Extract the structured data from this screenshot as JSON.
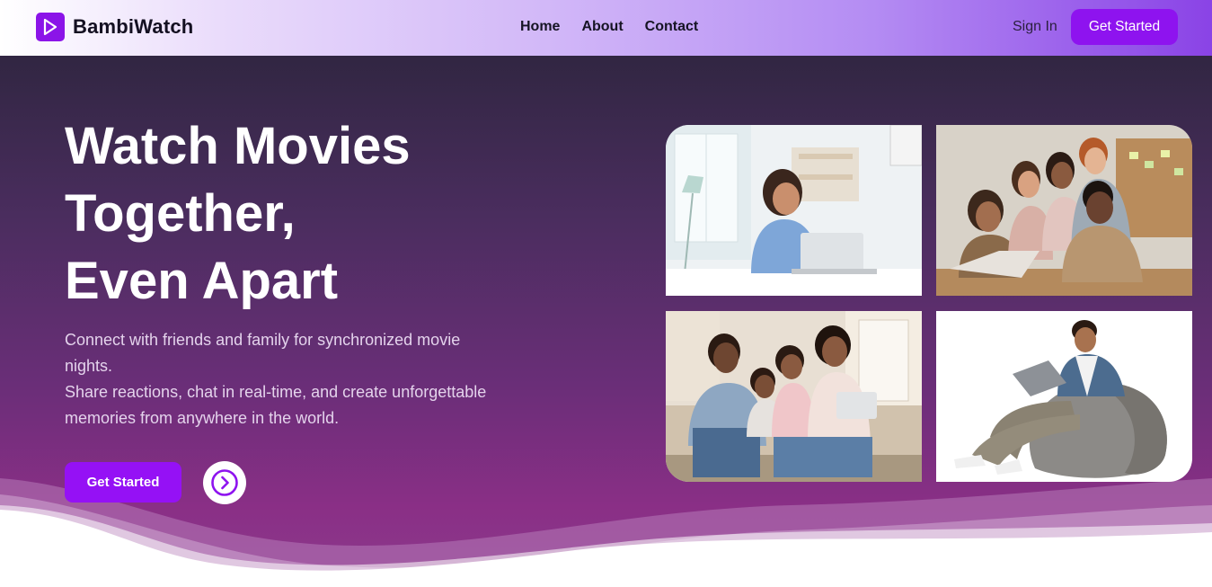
{
  "brand": {
    "name": "BambiWatch",
    "logo_icon": "play-icon",
    "accent": "#8b14e8"
  },
  "nav": {
    "links": [
      "Home",
      "About",
      "Contact"
    ],
    "sign_in": "Sign In",
    "cta": "Get Started"
  },
  "hero": {
    "title_lines": [
      "Watch Movies",
      "Together,",
      "Even Apart"
    ],
    "subtitle_lines": [
      "Connect with friends and family for synchronized movie",
      "nights.",
      "Share reactions, chat in real-time, and create unforgettable",
      "memories from anywhere in the world."
    ],
    "cta": "Get Started",
    "secondary_icon": "chevron-right-circle-icon"
  },
  "gallery": {
    "images": [
      "woman-working-on-laptop-photo",
      "group-of-friends-around-laptop-photo",
      "family-on-couch-with-tablet-photo",
      "man-on-beanbag-with-laptop-photo"
    ]
  },
  "colors": {
    "hero_top": "#312642",
    "hero_bottom": "#8a2f86",
    "button": "#9511f5"
  }
}
